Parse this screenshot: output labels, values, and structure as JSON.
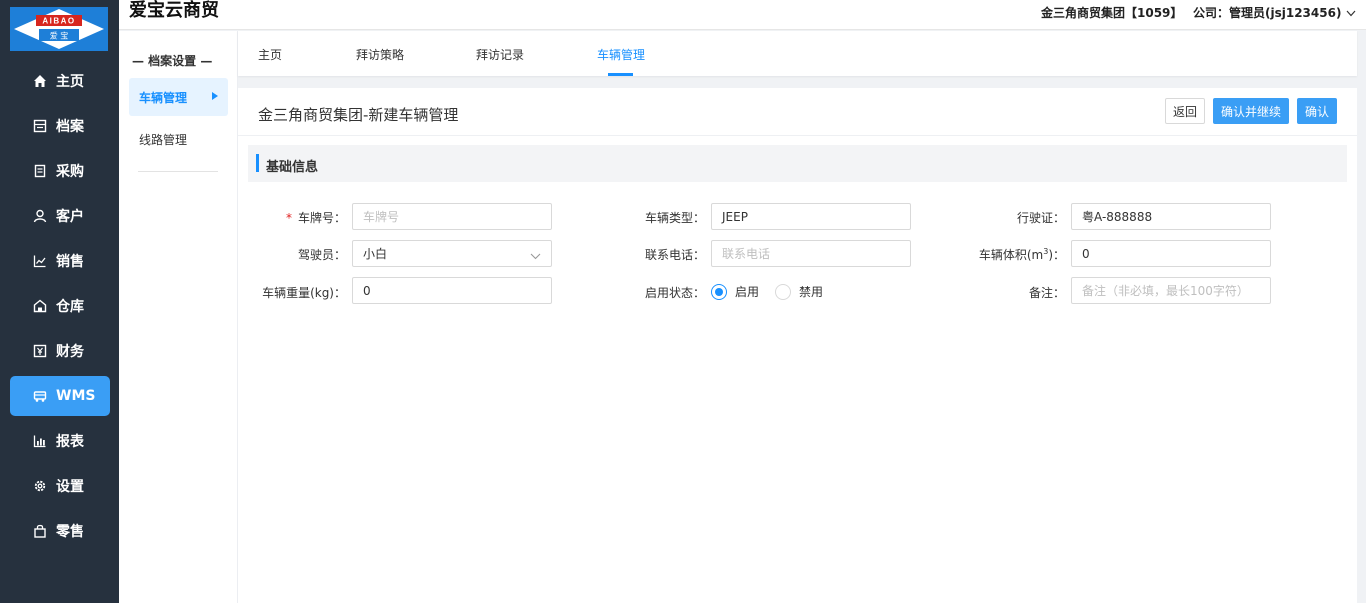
{
  "logo": {
    "top_text": "AIBAO",
    "bottom_text": "爱  宝"
  },
  "header": {
    "brand": "爱宝云商贸",
    "group": "金三角商贸集团【1059】",
    "user": "公司：管理员(jsj123456)"
  },
  "nav": {
    "items": [
      {
        "label": "主页",
        "icon": "home-icon"
      },
      {
        "label": "档案",
        "icon": "archive-icon"
      },
      {
        "label": "采购",
        "icon": "purchase-icon"
      },
      {
        "label": "客户",
        "icon": "user-icon"
      },
      {
        "label": "销售",
        "icon": "chart-line-icon"
      },
      {
        "label": "仓库",
        "icon": "warehouse-icon"
      },
      {
        "label": "财务",
        "icon": "finance-icon"
      },
      {
        "label": "WMS",
        "icon": "truck-icon"
      },
      {
        "label": "报表",
        "icon": "bar-chart-icon"
      },
      {
        "label": "设置",
        "icon": "gear-icon"
      },
      {
        "label": "零售",
        "icon": "bag-icon"
      }
    ],
    "active_index": 7
  },
  "subnav": {
    "title": "— 档案设置 —",
    "items": [
      {
        "label": "车辆管理"
      },
      {
        "label": "线路管理"
      }
    ]
  },
  "tabs": [
    {
      "label": "主页"
    },
    {
      "label": "拜访策略"
    },
    {
      "label": "拜访记录"
    },
    {
      "label": "车辆管理"
    }
  ],
  "panel": {
    "title": "金三角商贸集团-新建车辆管理",
    "buttons": {
      "back": "返回",
      "confirm_continue": "确认并继续",
      "confirm": "确认"
    },
    "section": "基础信息"
  },
  "form": {
    "plate": {
      "label": "车牌号：",
      "placeholder": "车牌号",
      "required_mark": "*"
    },
    "vehicle_type": {
      "label": "车辆类型：",
      "value": "JEEP"
    },
    "license": {
      "label": "行驶证：",
      "value": "粤A-888888"
    },
    "driver": {
      "label": "驾驶员：",
      "value": "小白"
    },
    "phone": {
      "label": "联系电话：",
      "placeholder": "联系电话"
    },
    "volume": {
      "label_main": "车辆体积(m",
      "label_sup": "3",
      "label_end": ")：",
      "value": "0"
    },
    "weight": {
      "label": "车辆重量(kg)：",
      "value": "0"
    },
    "status": {
      "label": "启用状态：",
      "options": [
        "启用",
        "禁用"
      ],
      "selected": "启用"
    },
    "remark": {
      "label": "备注：",
      "placeholder": "备注（非必填，最长100字符）"
    }
  },
  "colors": {
    "nav_bg": "#26313e",
    "accent": "#3a9ef5",
    "link": "#1890ff"
  }
}
